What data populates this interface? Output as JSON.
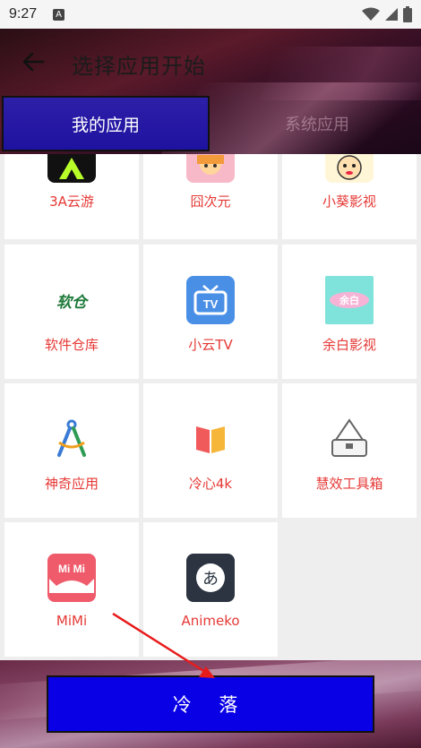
{
  "status_bar": {
    "time": "9:27",
    "notification_glyph": "A"
  },
  "header": {
    "title": "选择应用开始",
    "back_icon": "arrow-left-icon"
  },
  "tabs": [
    {
      "label": "我的应用",
      "active": true
    },
    {
      "label": "系统应用",
      "active": false
    }
  ],
  "apps": [
    {
      "name": "3A云游",
      "icon": "3a-cloud-game-icon"
    },
    {
      "name": "囧次元",
      "icon": "jiong-ciyuan-icon"
    },
    {
      "name": "小葵影视",
      "icon": "xiaokui-video-icon"
    },
    {
      "name": "软件仓库",
      "icon": "software-repo-icon"
    },
    {
      "name": "小云TV",
      "icon": "xiaoyun-tv-icon"
    },
    {
      "name": "余白影视",
      "icon": "yubai-video-icon"
    },
    {
      "name": "神奇应用",
      "icon": "compass-app-icon"
    },
    {
      "name": "冷心4k",
      "icon": "book-icon"
    },
    {
      "name": "慧效工具箱",
      "icon": "toolbox-icon"
    },
    {
      "name": "MiMi",
      "icon": "mimi-cat-icon"
    },
    {
      "name": "Animeko",
      "icon": "animeko-icon"
    }
  ],
  "icon_text": {
    "ruancang": "软仓",
    "tv": "TV",
    "mimi": "Mi Mi",
    "animeko": "あ"
  },
  "footer": {
    "button_label": "冷 落"
  },
  "colors": {
    "accent_red": "#e53935",
    "button_blue": "#0a00e6",
    "tab_active": "#2e1fa8"
  }
}
